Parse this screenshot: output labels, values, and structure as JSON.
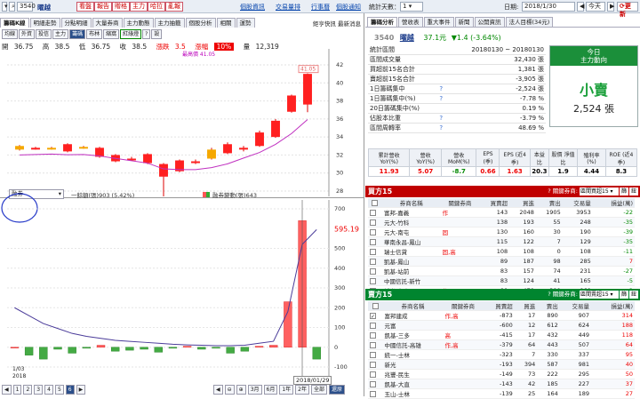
{
  "toolbar": {
    "stock_code": "3540",
    "stock_name": "曜越",
    "buttons": [
      "看盤",
      "報告",
      "贈格",
      "主力",
      "哈拉",
      "亂報"
    ],
    "links": [
      "個股資訊",
      "交易量排",
      "行事曆",
      "個股通知"
    ],
    "stat_days_label": "統計天數：",
    "stat_days_value": "1",
    "date_label": "日期:",
    "date_value": "2018/1/30",
    "today_label": "今天",
    "refresh_label": "更新"
  },
  "left": {
    "tabs": [
      "籌碼K線",
      "明細走勢",
      "分點明細",
      "大量券商",
      "主力動態",
      "主力抽籤",
      "個股分析",
      "相關",
      "運勢"
    ],
    "notice": "鉅亨快訊 最新消息",
    "subtabs": [
      "均線",
      "外資",
      "投信",
      "主力",
      "籌碼",
      "布林",
      "縮窩",
      "紅綠燈",
      "?",
      "設"
    ],
    "ohlc": {
      "open_label": "開",
      "open": "36.75",
      "high_label": "高",
      "high": "38.5",
      "low_label": "低",
      "low": "36.75",
      "close_label": "收",
      "close": "38.5",
      "change_label": "漲跌",
      "change": "3.5",
      "pct_label": "漲幅",
      "pct": "10%",
      "vol_label": "量",
      "vol": "12,319"
    },
    "upper_y_ticks": [
      "42",
      "40",
      "38",
      "36",
      "34",
      "32",
      "30",
      "28"
    ],
    "label_top": "最高價 41.05",
    "label_high_box": "41.05",
    "label_low": "26.6",
    "selector_value": "融券",
    "legend_a": "一餘額(張)903 (5.42%)",
    "legend_b": "融券變動(張)643",
    "lower_y_ticks": [
      "700",
      "595.19",
      "500",
      "400",
      "300",
      "200",
      "100",
      "0",
      "-100"
    ],
    "date_start": "1/03",
    "date_year": "2018",
    "date_cursor": "2018/01/29",
    "pages": [
      "1",
      "2",
      "3",
      "4",
      "5",
      "6"
    ],
    "ranges": [
      "3月",
      "6月",
      "1年",
      "2年",
      "全部",
      "還原"
    ]
  },
  "right": {
    "tabs": [
      "籌碼分析",
      "營收表",
      "重大事件",
      "新聞",
      "公開資訊",
      "法人目標(34元)"
    ],
    "code": "3540",
    "name": "曜越",
    "price": "37.1元",
    "change": "▼1.4 (-3.64%)",
    "info_rows": [
      {
        "label": "統計區間",
        "value": "20180130 ~ 20180130",
        "hint": ""
      },
      {
        "label": "區間成交量",
        "value": "32,430 張",
        "hint": ""
      },
      {
        "label": "買超前15名合計",
        "value": "1,381 張",
        "hint": ""
      },
      {
        "label": "賣超前15名合計",
        "value": "-3,905 張",
        "hint": ""
      },
      {
        "label": "1日籌碼集中",
        "value": "-2,524 張",
        "hint": "?"
      },
      {
        "label": "1日籌碼集中(%)",
        "value": "-7.78 %",
        "hint": "?"
      },
      {
        "label": "20日籌碼集中(%)",
        "value": "0.19 %",
        "hint": ""
      },
      {
        "label": "佔股本比重",
        "value": "-3.79 %",
        "hint": "?"
      },
      {
        "label": "區間周轉率",
        "value": "48.69 %",
        "hint": "?"
      }
    ],
    "today_box": {
      "title1": "今日",
      "title2": "主力動向",
      "verdict": "小賣",
      "amount": "2,524 張"
    },
    "fin_headers": [
      "累計營收 YoY(%)",
      "營收 YoY(%)",
      "營收 MoM(%)",
      "EPS (季)",
      "EPS (近4季)",
      "本益比",
      "股價 淨值比",
      "殖利率 (%)",
      "ROE (近4季)"
    ],
    "fin_values": [
      "11.93",
      "5.07",
      "-8.7",
      "0.66",
      "1.63",
      "20.3",
      "1.9",
      "4.44",
      "8.3"
    ],
    "buy": {
      "title": "買方15",
      "assoc_label": "關鍵券商:",
      "assoc_value": "區間買超15",
      "btn1": "篩",
      "btn2": "鈕",
      "headers": [
        "券商名稱",
        "關鍵券商",
        "買賣超",
        "買進",
        "賣出",
        "交易量",
        "",
        "損益(萬)"
      ],
      "rows": [
        [
          "富邦-嘉義",
          "作",
          "143",
          "2048",
          "1905",
          "3953",
          "",
          "-22"
        ],
        [
          "元大-竹科",
          "",
          "138",
          "193",
          "55",
          "248",
          "",
          "-35"
        ],
        [
          "元大-南屯",
          "固",
          "130",
          "160",
          "30",
          "190",
          "",
          "-39"
        ],
        [
          "華南永昌-鳳山",
          "",
          "115",
          "122",
          "7",
          "129",
          "",
          "-35"
        ],
        [
          "瑞士信貸",
          "固,高",
          "108",
          "108",
          "0",
          "108",
          "",
          "-11"
        ],
        [
          "凱基-鳳山",
          "",
          "89",
          "187",
          "98",
          "285",
          "",
          "7"
        ],
        [
          "凱基-站前",
          "",
          "83",
          "157",
          "74",
          "231",
          "",
          "-27"
        ],
        [
          "中國信託-新竹",
          "",
          "83",
          "124",
          "41",
          "165",
          "",
          "-5"
        ],
        [
          "新光-台中",
          "作",
          "80",
          "470",
          "390",
          "860",
          "",
          "-2"
        ]
      ]
    },
    "sell": {
      "title": "賣方15",
      "assoc_label": "關鍵券商:",
      "assoc_value": "區間賣超15",
      "btn1": "篩",
      "btn2": "鈕",
      "headers": [
        "券商名稱",
        "關鍵券商",
        "買賣超",
        "買進",
        "賣出",
        "交易量",
        "",
        "損益(萬)"
      ],
      "rows": [
        [
          "富邦建成",
          "作,高",
          "-873",
          "17",
          "890",
          "907",
          "",
          "314"
        ],
        [
          "元富",
          "",
          "-600",
          "12",
          "612",
          "624",
          "",
          "188"
        ],
        [
          "凱基-三多",
          "高",
          "-415",
          "17",
          "432",
          "449",
          "",
          "118"
        ],
        [
          "中國信託-高雄",
          "作,高",
          "-379",
          "64",
          "443",
          "507",
          "",
          "64"
        ],
        [
          "統一-士林",
          "",
          "-323",
          "7",
          "330",
          "337",
          "",
          "95"
        ],
        [
          "新光",
          "",
          "-193",
          "394",
          "587",
          "981",
          "",
          "40"
        ],
        [
          "兆豐-民生",
          "",
          "-149",
          "73",
          "222",
          "295",
          "",
          "50"
        ],
        [
          "凱基-大直",
          "",
          "-143",
          "42",
          "185",
          "227",
          "",
          "37"
        ],
        [
          "玉山-士林",
          "",
          "-139",
          "25",
          "164",
          "189",
          "",
          "27"
        ]
      ]
    }
  },
  "colors": {
    "up": "#ff2020",
    "down": "#00aa00",
    "buy_header": "#c00000",
    "sell_header": "#00852f",
    "accent": "#2b4f8a"
  },
  "chart_data": [
    {
      "type": "candlestick",
      "y_axis": [
        28,
        42
      ],
      "candles": [
        {
          "o": 33.0,
          "c": 32.6,
          "h": 33.1,
          "l": 32.5
        },
        {
          "o": 32.8,
          "c": 32.7,
          "h": 32.9,
          "l": 32.6
        },
        {
          "o": 32.7,
          "c": 32.8,
          "h": 32.9,
          "l": 32.6
        },
        {
          "o": 33.2,
          "c": 32.4,
          "h": 33.3,
          "l": 32.3
        },
        {
          "o": 32.9,
          "c": 32.8,
          "h": 33.0,
          "l": 32.7
        },
        {
          "o": 32.8,
          "c": 31.8,
          "h": 32.9,
          "l": 31.7
        },
        {
          "o": 32.0,
          "c": 31.3,
          "h": 32.1,
          "l": 31.2
        },
        {
          "o": 31.6,
          "c": 31.5,
          "h": 31.8,
          "l": 31.4
        },
        {
          "o": 32.1,
          "c": 31.1,
          "h": 32.2,
          "l": 31.0
        },
        {
          "o": 31.0,
          "c": 29.6,
          "h": 31.1,
          "l": 26.6
        },
        {
          "o": 30.2,
          "c": 31.4,
          "h": 31.5,
          "l": 30.1
        },
        {
          "o": 31.2,
          "c": 31.3,
          "h": 31.5,
          "l": 31.0
        },
        {
          "o": 31.6,
          "c": 32.6,
          "h": 32.8,
          "l": 31.5
        },
        {
          "o": 32.2,
          "c": 33.2,
          "h": 33.4,
          "l": 32.1
        },
        {
          "o": 32.6,
          "c": 32.8,
          "h": 33.0,
          "l": 32.4
        },
        {
          "o": 33.0,
          "c": 34.5,
          "h": 34.7,
          "l": 32.9
        },
        {
          "o": 34.0,
          "c": 35.8,
          "h": 36.0,
          "l": 33.9
        },
        {
          "o": 36.8,
          "c": 38.6,
          "h": 38.7,
          "l": 36.7
        },
        {
          "o": 37.6,
          "c": 41.0,
          "h": 41.05,
          "l": 36.75
        }
      ]
    },
    {
      "type": "bar",
      "series_name": "融券變動(張)",
      "y_axis": [
        -100,
        700
      ],
      "values": [
        0,
        -40,
        -60,
        -10,
        -30,
        -5,
        10,
        -20,
        -15,
        -10,
        -25,
        -5,
        5,
        -10,
        -5,
        -30,
        -20,
        5,
        10,
        230,
        640,
        -60
      ],
      "line_values": [
        200,
        160,
        120,
        95,
        70,
        55,
        45,
        35,
        30,
        25,
        20,
        15,
        12,
        10,
        8,
        8,
        10,
        20,
        30,
        180,
        520,
        595
      ]
    }
  ]
}
